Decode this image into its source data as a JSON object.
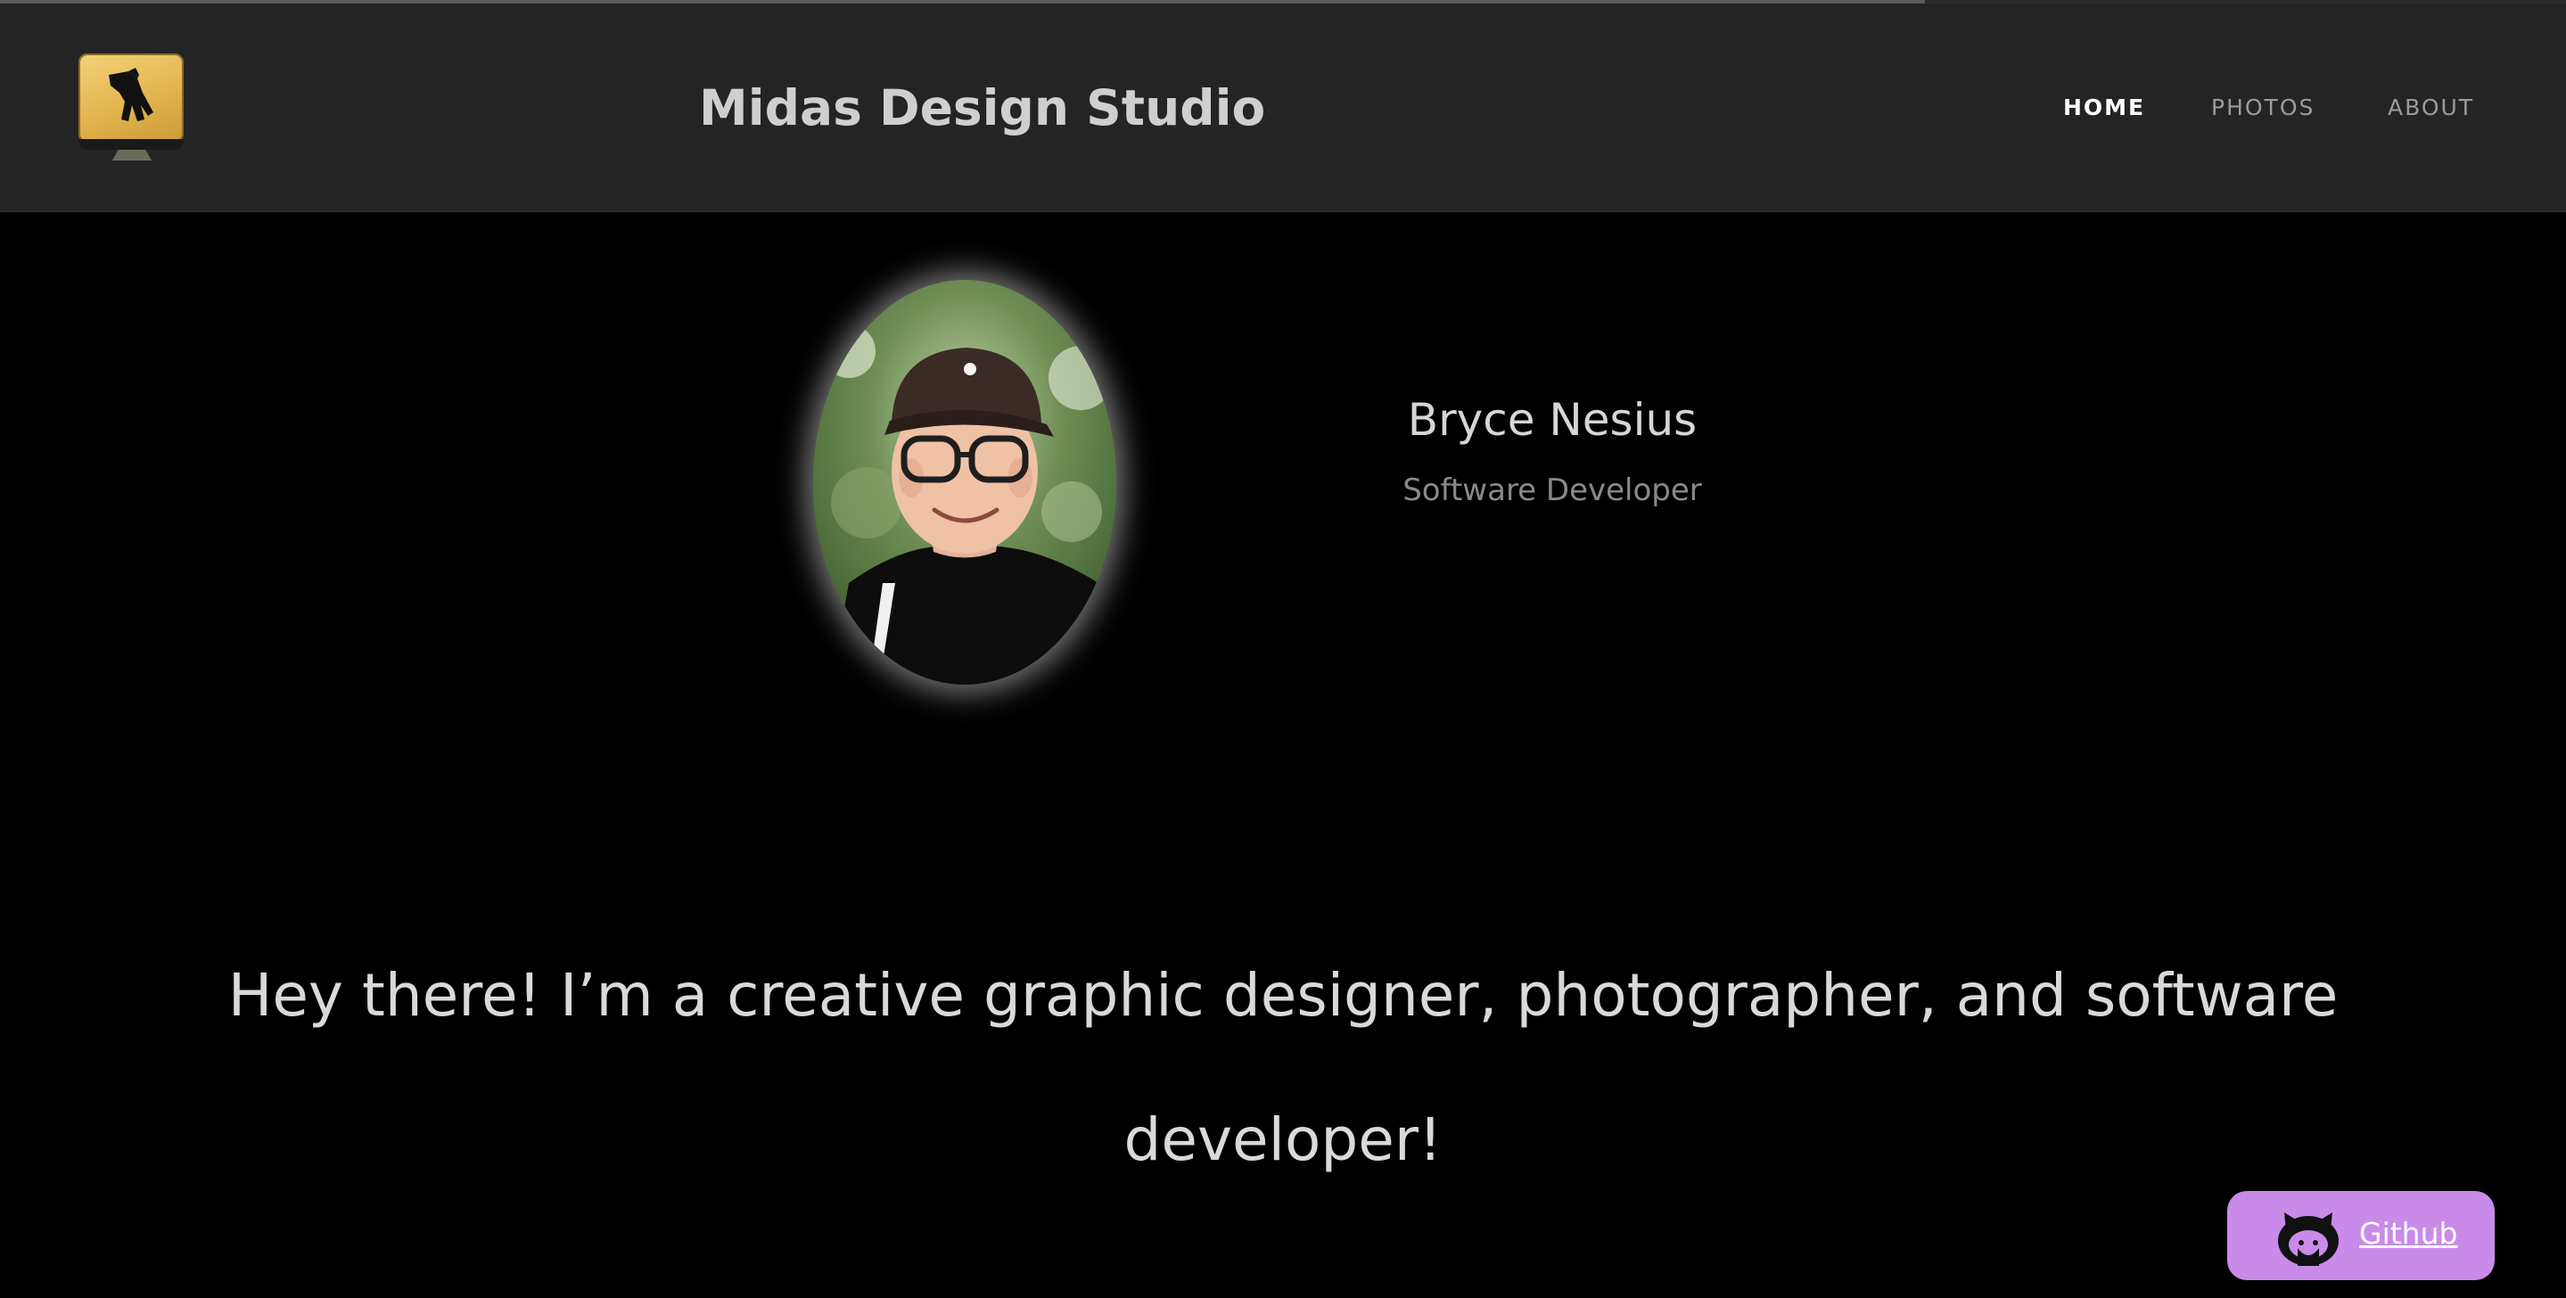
{
  "header": {
    "logo_icon": "computer-hand-icon",
    "title": "Midas Design Studio",
    "nav": [
      {
        "label": "HOME",
        "active": true
      },
      {
        "label": "PHOTOS",
        "active": false
      },
      {
        "label": "ABOUT",
        "active": false
      }
    ]
  },
  "scroll_progress": 0.75,
  "profile": {
    "name": "Bryce Nesius",
    "role": "Software Developer",
    "avatar": "profile-photo"
  },
  "intro": {
    "text": "Hey there! I’m a creative graphic designer, photographer, and software developer!"
  },
  "github_button": {
    "label": "Github",
    "icon": "github-icon",
    "color": "#c98bea"
  },
  "colors": {
    "background": "#000000",
    "header_background": "#242424",
    "logo_gold": "#e3b44e"
  }
}
